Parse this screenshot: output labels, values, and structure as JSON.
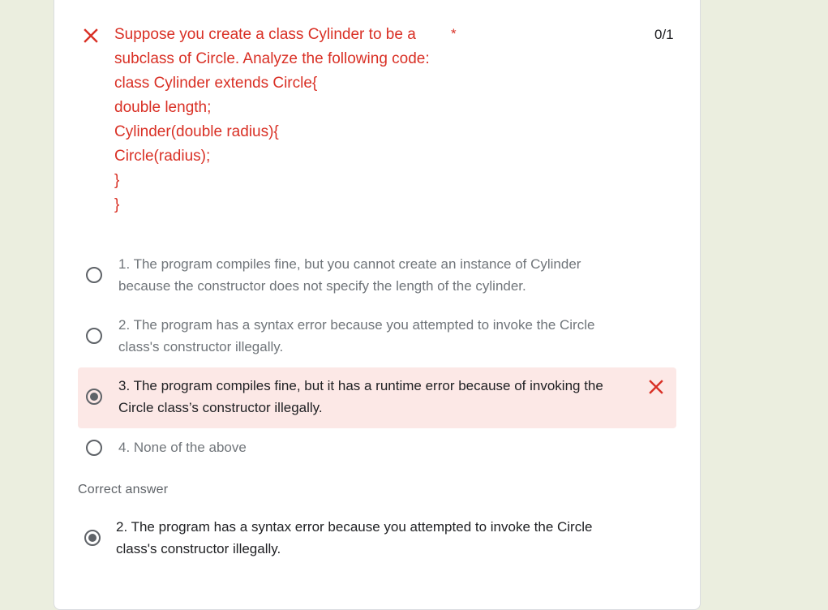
{
  "question": {
    "title_lines": [
      "Suppose you create a class Cylinder to be a",
      "subclass of Circle. Analyze the following code:",
      "class Cylinder extends Circle{",
      "double length;",
      "Cylinder(double radius){",
      "Circle(radius);",
      "}",
      "}"
    ],
    "required_marker": "*",
    "score": "0/1",
    "status_icon": "close-icon",
    "status_color": "#d93025"
  },
  "options": [
    {
      "lines": [
        "1. The program compiles fine, but you cannot create an instance of Cylinder",
        "because the constructor does not specify the length of the cylinder."
      ],
      "selected": false
    },
    {
      "lines": [
        "2. The program has a syntax error because you attempted to invoke the Circle",
        "class's constructor illegally."
      ],
      "selected": false
    },
    {
      "lines": [
        "3. The program compiles fine, but it has a runtime error because of invoking the",
        "Circle class’s constructor illegally."
      ],
      "selected": true,
      "marked_wrong": true,
      "highlight_color": "#fce8e6"
    },
    {
      "lines": [
        "4. None of the above"
      ],
      "selected": false
    }
  ],
  "correct_answer": {
    "label": "Correct answer",
    "lines": [
      "2. The program has a syntax error because you attempted to invoke the Circle",
      "class's constructor illegally."
    ],
    "selected": true
  }
}
